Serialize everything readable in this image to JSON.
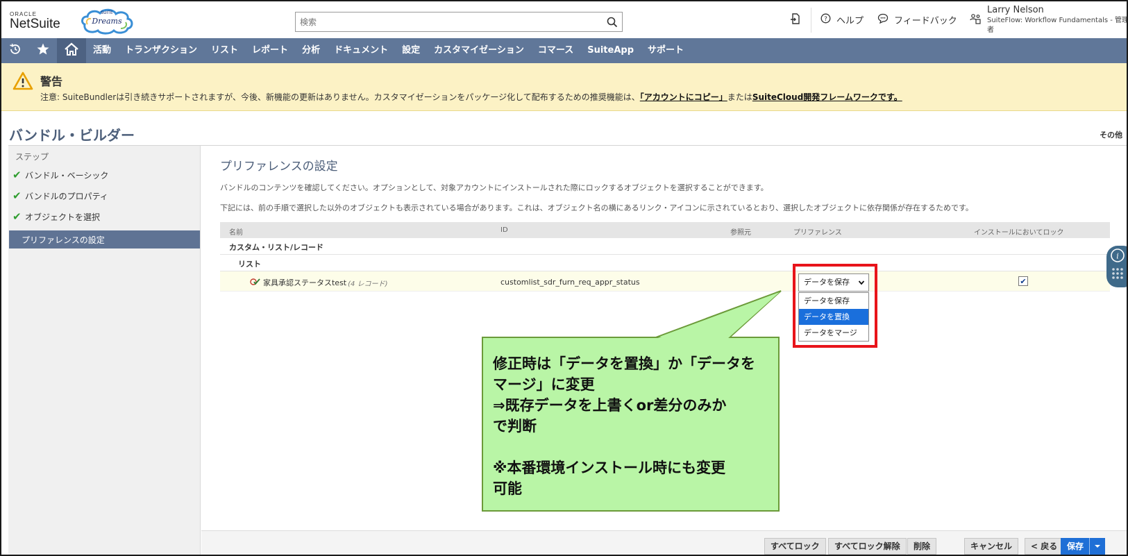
{
  "header": {
    "logo_oracle": "ORACLE",
    "logo_netsuite": "NetSuite",
    "badge_suite": "SUITE",
    "badge_dreams": "Dreams",
    "search_placeholder": "検索",
    "help_label": "ヘルプ",
    "feedback_label": "フィードバック",
    "user_name": "Larry Nelson",
    "user_role": "SuiteFlow: Workflow Fundamentals - 管理者"
  },
  "nav": {
    "items": [
      "活動",
      "トランザクション",
      "リスト",
      "レポート",
      "分析",
      "ドキュメント",
      "設定",
      "カスタマイゼーション",
      "コマース",
      "SuiteApp",
      "サポート"
    ]
  },
  "warning": {
    "title": "警告",
    "text_prefix": "注意: SuiteBundlerは引き続きサポートされますが、今後、新機能の更新はありません。カスタマイゼーションをパッケージ化して配布するための推奨機能は、",
    "link1": "「アカウントにコピー」",
    "text_mid": "または",
    "link2": "SuiteCloud開発フレームワークです。"
  },
  "page": {
    "title": "バンドル・ビルダー",
    "more_label": "その他"
  },
  "sidebar": {
    "heading": "ステップ",
    "steps": [
      {
        "label": "バンドル・ベーシック",
        "done": true
      },
      {
        "label": "バンドルのプロパティ",
        "done": true
      },
      {
        "label": "オブジェクトを選択",
        "done": true
      },
      {
        "label": "プリファレンスの設定",
        "active": true
      }
    ]
  },
  "main": {
    "section_title": "プリファレンスの設定",
    "desc1": "バンドルのコンテンツを確認してください。オプションとして、対象アカウントにインストールされた際にロックするオブジェクトを選択することができます。",
    "desc2": "下記には、前の手順で選択した以外のオブジェクトも表示されている場合があります。これは、オブジェクト名の横にあるリンク・アイコンに示されているとおり、選択したオブジェクトに依存関係が存在するためです。",
    "columns": [
      "名前",
      "ID",
      "参照元",
      "プリファレンス",
      "インストールにおいてロック"
    ],
    "group1": "カスタム・リスト/レコード",
    "group2": "リスト",
    "row": {
      "name": "家具承認ステータスtest",
      "count": "(4 レコード)",
      "id": "customlist_sdr_furn_req_appr_status",
      "preference": "データを保存",
      "locked": true
    },
    "dropdown_options": [
      "データを保存",
      "データを置換",
      "データをマージ"
    ],
    "dropdown_selected_index": 1
  },
  "callout": {
    "text": "修正時は「データを置換」か「データを\nマージ」に変更\n⇒既存データを上書くor差分のみか\nで判断\n\n※本番環境インストール時にも変更\n可能"
  },
  "footer": {
    "lock_all": "すべてロック",
    "unlock_all": "すべてロック解除",
    "delete": "削除",
    "cancel": "キャンセル",
    "back": "< 戻る",
    "save": "保存"
  },
  "colors": {
    "nav_bg": "#607799",
    "warning_bg": "#fcf2c5",
    "primary_button": "#1f6fd6",
    "callout_bg": "#b9f5a6",
    "highlight_border": "#e8141a"
  }
}
